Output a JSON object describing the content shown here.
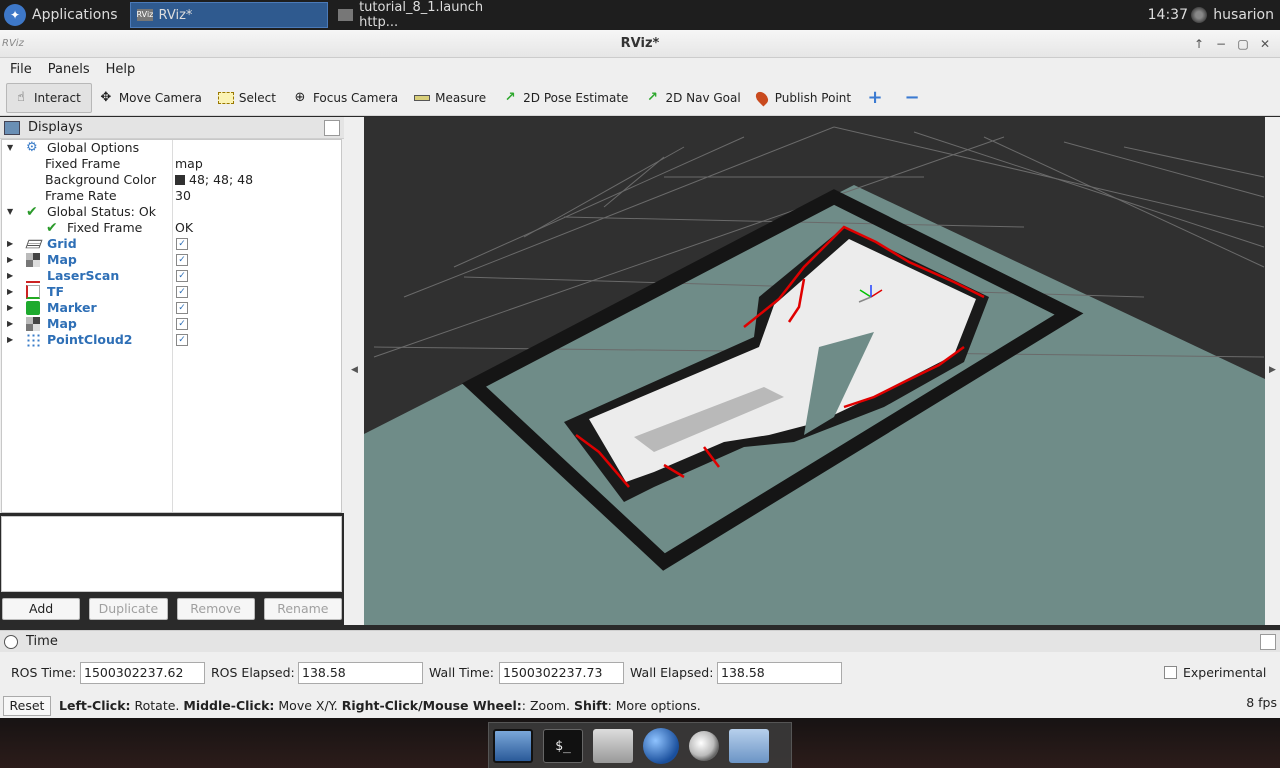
{
  "taskbar": {
    "applications_label": "Applications",
    "tasks": [
      {
        "label": "RViz*",
        "icon": "RViz"
      },
      {
        "label": "tutorial_8_1.launch http..."
      }
    ],
    "clock": "14:37",
    "user": "husarion"
  },
  "window": {
    "title": "RViz*",
    "icon_label": "RViz"
  },
  "menu": {
    "items": [
      "File",
      "Panels",
      "Help"
    ]
  },
  "toolbar": {
    "tools": [
      {
        "label": "Interact",
        "icon": "hand-icon"
      },
      {
        "label": "Move Camera",
        "icon": "move-camera-icon"
      },
      {
        "label": "Select",
        "icon": "select-icon"
      },
      {
        "label": "Focus Camera",
        "icon": "focus-camera-icon"
      },
      {
        "label": "Measure",
        "icon": "ruler-icon"
      },
      {
        "label": "2D Pose Estimate",
        "icon": "green-arrow-icon"
      },
      {
        "label": "2D Nav Goal",
        "icon": "green-arrow-icon"
      },
      {
        "label": "Publish Point",
        "icon": "pin-icon"
      }
    ]
  },
  "displays": {
    "title": "Displays",
    "global_options": "Global Options",
    "fixed_frame_label": "Fixed Frame",
    "fixed_frame_value": "map",
    "bg_color_label": "Background Color",
    "bg_color_value": "48; 48; 48",
    "frame_rate_label": "Frame Rate",
    "frame_rate_value": "30",
    "global_status": "Global Status: Ok",
    "status_fixed_frame_label": "Fixed Frame",
    "status_fixed_frame_value": "OK",
    "items": [
      {
        "label": "Grid",
        "icon": "grid-icon"
      },
      {
        "label": "Map",
        "icon": "map-icon"
      },
      {
        "label": "LaserScan",
        "icon": "laser-scan-icon"
      },
      {
        "label": "TF",
        "icon": "tf-icon"
      },
      {
        "label": "Marker",
        "icon": "marker-icon"
      },
      {
        "label": "Map",
        "icon": "map-icon"
      },
      {
        "label": "PointCloud2",
        "icon": "point-cloud-icon"
      }
    ],
    "check_glyph": "✓",
    "buttons": {
      "add": "Add",
      "duplicate": "Duplicate",
      "remove": "Remove",
      "rename": "Rename"
    }
  },
  "time": {
    "title": "Time",
    "ros_time_label": "ROS Time:",
    "ros_time": "1500302237.62",
    "ros_elapsed_label": "ROS Elapsed:",
    "ros_elapsed": "138.58",
    "wall_time_label": "Wall Time:",
    "wall_time": "1500302237.73",
    "wall_elapsed_label": "Wall Elapsed:",
    "wall_elapsed": "138.58",
    "experimental_label": "Experimental"
  },
  "status": {
    "reset_label": "Reset",
    "hint_parts": [
      {
        "b": "Left-Click:",
        "t": " Rotate. "
      },
      {
        "b": "Middle-Click:",
        "t": " Move X/Y. "
      },
      {
        "b": "Right-Click/Mouse Wheel:",
        "t": ": Zoom. "
      },
      {
        "b": "Shift",
        "t": ": More options."
      }
    ],
    "fps": "8 fps"
  },
  "dock": {
    "terminal_glyph": "$_"
  },
  "colors": {
    "view_background": "#303030",
    "floor": "#6f8c88",
    "wall": "#111111",
    "free_space": "#eeeeee",
    "laser": "#e00000"
  }
}
